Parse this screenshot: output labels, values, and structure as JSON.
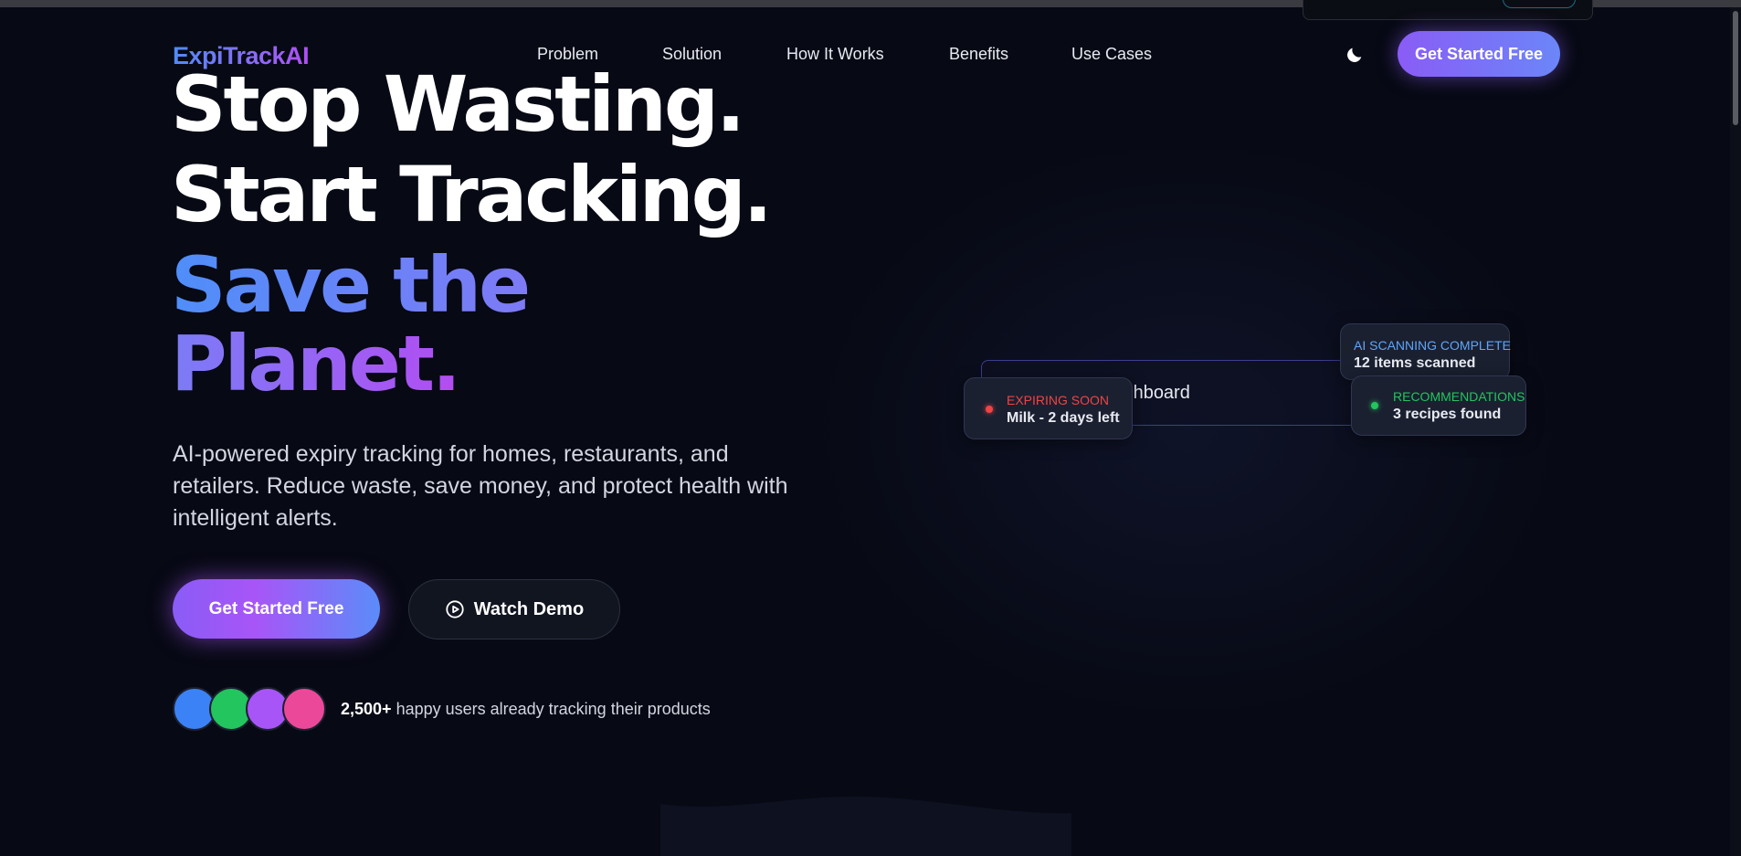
{
  "nav": {
    "logo": "ExpiTrackAI",
    "links": [
      "Problem",
      "Solution",
      "How It Works",
      "Benefits",
      "Use Cases"
    ],
    "theme_icon": "moon-icon",
    "cta_label": "Get Started Free"
  },
  "hero": {
    "line1": "Stop Wasting.",
    "line2": "Start Tracking.",
    "line3": "Save the",
    "line4": "Planet.",
    "subtitle": "AI-powered expiry tracking for homes, restaurants, and retailers. Reduce waste, save money, and protect health with intelligent alerts.",
    "primary_cta": "Get Started Free",
    "secondary_cta": "Watch Demo",
    "secondary_cta_icon": "play-circle-icon",
    "avatar_colors": [
      "#3b82f6",
      "#22c55e",
      "#a855f7",
      "#ec4899"
    ],
    "social_count": "2,500+",
    "social_text": " happy users already tracking their products"
  },
  "dashboard": {
    "label": "Dashboard",
    "cards": {
      "expiring": {
        "title": "EXPIRING SOON",
        "value": "Milk - 2 days left",
        "color": "#ef4444"
      },
      "scan": {
        "title": "AI SCANNING COMPLETE",
        "value": "12 items scanned",
        "color": "#60a5fa"
      },
      "recommendations": {
        "title": "RECOMMENDATIONS",
        "value": "3 recipes found",
        "color": "#22c55e"
      }
    }
  },
  "colors": {
    "background": "#070914",
    "accent_purple": "#8a5cf6",
    "accent_blue": "#4f8bf9"
  }
}
